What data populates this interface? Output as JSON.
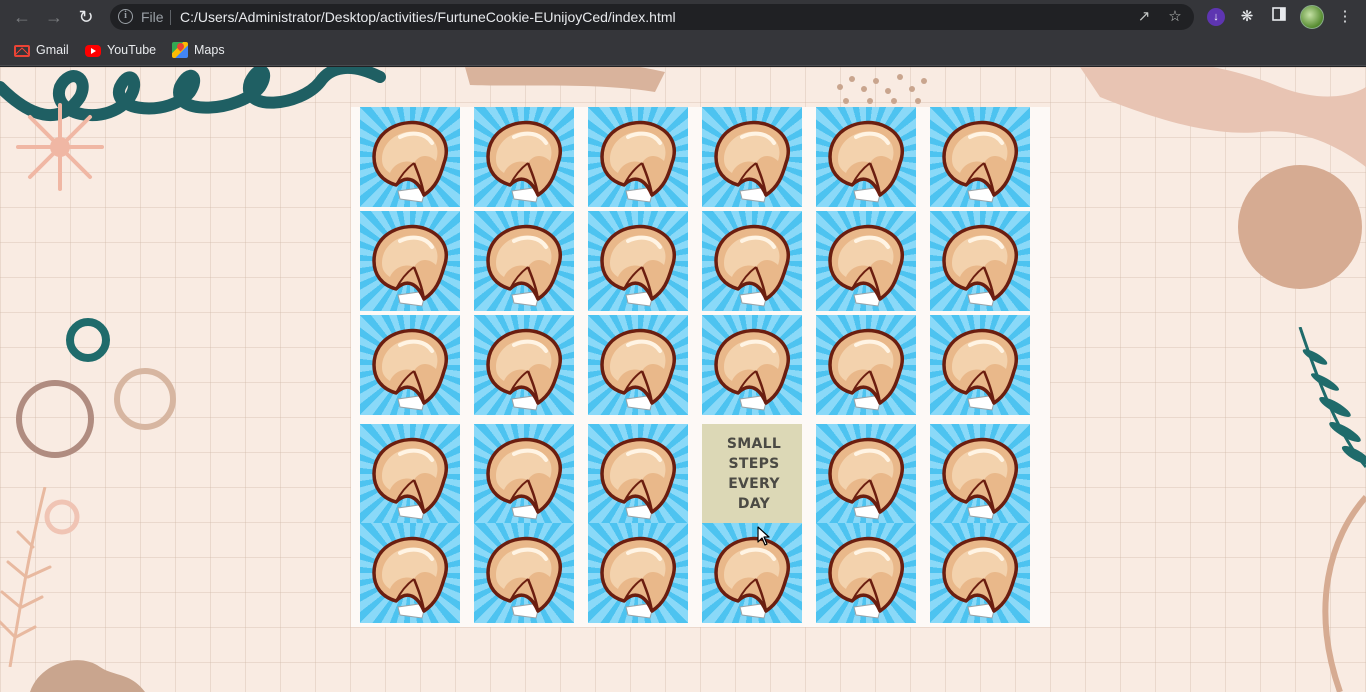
{
  "browser": {
    "scheme_label": "File",
    "url": "C:/Users/Administrator/Desktop/activities/FurtuneCookie-EUnijoyCed/index.html",
    "icons": [
      "back-icon",
      "forward-icon",
      "reload-icon",
      "info-icon",
      "share-icon",
      "star-icon",
      "download-icon",
      "extensions-icon",
      "side-panel-icon",
      "profile-avatar",
      "menu-icon"
    ]
  },
  "bookmarks": [
    {
      "label": "Gmail",
      "icon": "gmail-icon"
    },
    {
      "label": "YouTube",
      "icon": "youtube-icon"
    },
    {
      "label": "Maps",
      "icon": "maps-icon"
    }
  ],
  "game": {
    "rows": 5,
    "columns": 6,
    "card_icon": "fortune-cookie-icon",
    "revealed_card": {
      "row": 4,
      "column": 4,
      "lines": [
        "SMALL",
        "STEPS",
        "EVERY DAY"
      ]
    }
  },
  "colors": {
    "card_rays_dark": "#4dc3f0",
    "card_rays_light": "#8ad9f8",
    "revealed_card_bg": "#dcd8b6",
    "page_bg": "#f9ebe2"
  }
}
